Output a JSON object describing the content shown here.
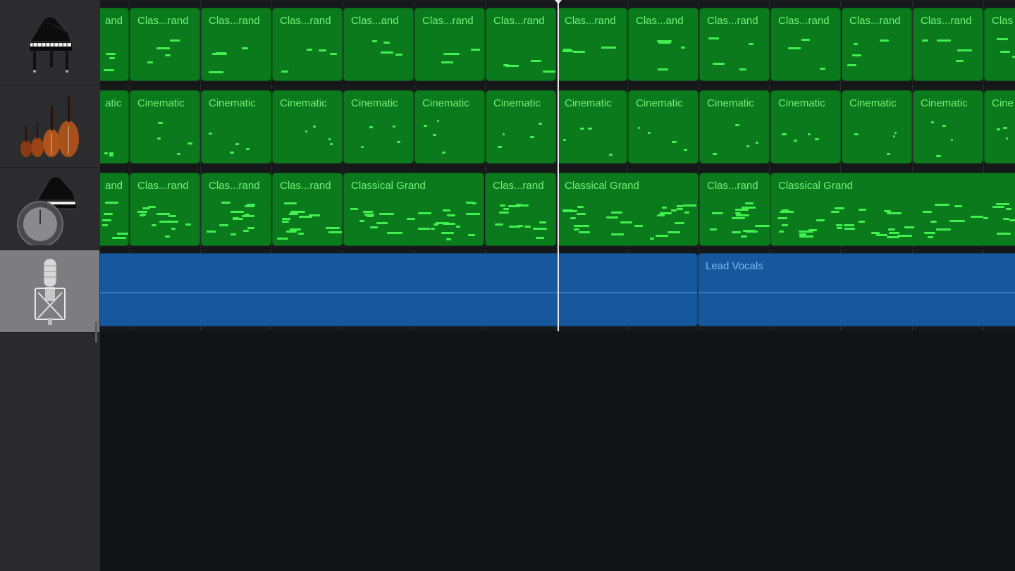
{
  "app": {
    "accent": "#0a7a1d",
    "audio_color": "#17579c",
    "selected_track_color": "#7d7d80"
  },
  "track_headers": [
    {
      "icon": "grand-piano-icon",
      "selected": false
    },
    {
      "icon": "string-ensemble-icon",
      "selected": false
    },
    {
      "icon": "piano-with-knob-icon",
      "selected": false
    },
    {
      "icon": "microphone-icon",
      "selected": true
    }
  ],
  "tracks": [
    {
      "name": "track-1-piano",
      "regions": [
        {
          "label": "and"
        },
        {
          "label": "Clas...rand"
        },
        {
          "label": "Clas...rand"
        },
        {
          "label": "Clas...rand"
        },
        {
          "label": "Clas...and"
        },
        {
          "label": "Clas...rand"
        },
        {
          "label": "Clas...rand"
        },
        {
          "label": "Clas...rand"
        },
        {
          "label": "Clas...and"
        },
        {
          "label": "Clas...rand"
        },
        {
          "label": "Clas...rand"
        },
        {
          "label": "Clas...rand"
        },
        {
          "label": "Clas...rand"
        },
        {
          "label": "Clas"
        }
      ]
    },
    {
      "name": "track-2-strings",
      "regions": [
        {
          "label": "atic"
        },
        {
          "label": "Cinematic"
        },
        {
          "label": "Cinematic"
        },
        {
          "label": "Cinematic"
        },
        {
          "label": "Cinematic"
        },
        {
          "label": "Cinematic"
        },
        {
          "label": "Cinematic"
        },
        {
          "label": "Cinematic"
        },
        {
          "label": "Cinematic"
        },
        {
          "label": "Cinematic"
        },
        {
          "label": "Cinematic"
        },
        {
          "label": "Cinematic"
        },
        {
          "label": "Cinematic"
        },
        {
          "label": "Cine"
        }
      ]
    },
    {
      "name": "track-3-piano",
      "regions": [
        {
          "label": "and"
        },
        {
          "label": "Clas...rand"
        },
        {
          "label": "Clas...rand"
        },
        {
          "label": "Clas...rand"
        },
        {
          "label": "Classical Grand"
        },
        {
          "label": "Clas...rand"
        },
        {
          "label": "Classical Grand"
        },
        {
          "label": "Clas...rand"
        },
        {
          "label": "Classical Grand"
        }
      ]
    },
    {
      "name": "track-4-vocals",
      "regions": [
        {
          "label": ""
        },
        {
          "label": "Lead Vocals"
        }
      ]
    }
  ]
}
